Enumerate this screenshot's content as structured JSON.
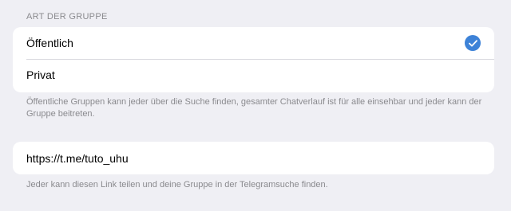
{
  "group_type": {
    "header": "ART DER GRUPPE",
    "options": [
      {
        "label": "Öffentlich",
        "selected": true
      },
      {
        "label": "Privat",
        "selected": false
      }
    ],
    "footer": "Öffentliche Gruppen kann jeder über die Suche finden, gesamter Chatverlauf ist für alle einsehbar und jeder kann der Gruppe beitreten."
  },
  "link": {
    "value": "https://t.me/tuto_uhu",
    "footer": "Jeder kann diesen Link teilen und deine Gruppe in der Telegramsuche finden."
  },
  "colors": {
    "accent": "#3d82d7",
    "background": "#efeff4",
    "secondary_text": "#8a8a8e"
  },
  "icons": {
    "selected_indicator": "checkmark-circle-icon"
  }
}
